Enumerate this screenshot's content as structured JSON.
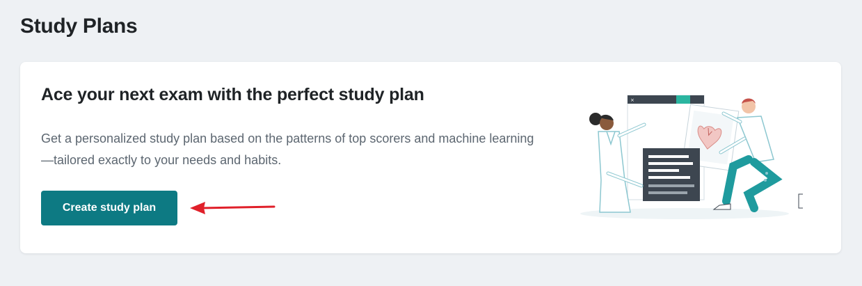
{
  "page": {
    "title": "Study Plans"
  },
  "promo_card": {
    "heading": "Ace your next exam with the perfect study plan",
    "description": "Get a personalized study plan based on the patterns of top scorers and machine learning—tailored exactly to your needs and habits.",
    "button_label": "Create study plan",
    "illustration_icon": "doctors-with-heart-chart-illustration",
    "annotation_icon": "red-arrow-left-icon"
  },
  "colors": {
    "background": "#eef1f4",
    "card": "#ffffff",
    "primary_button": "#0d7a83",
    "heading_text": "#1f2326",
    "body_text": "#5c6670",
    "annotation": "#e0202a"
  }
}
